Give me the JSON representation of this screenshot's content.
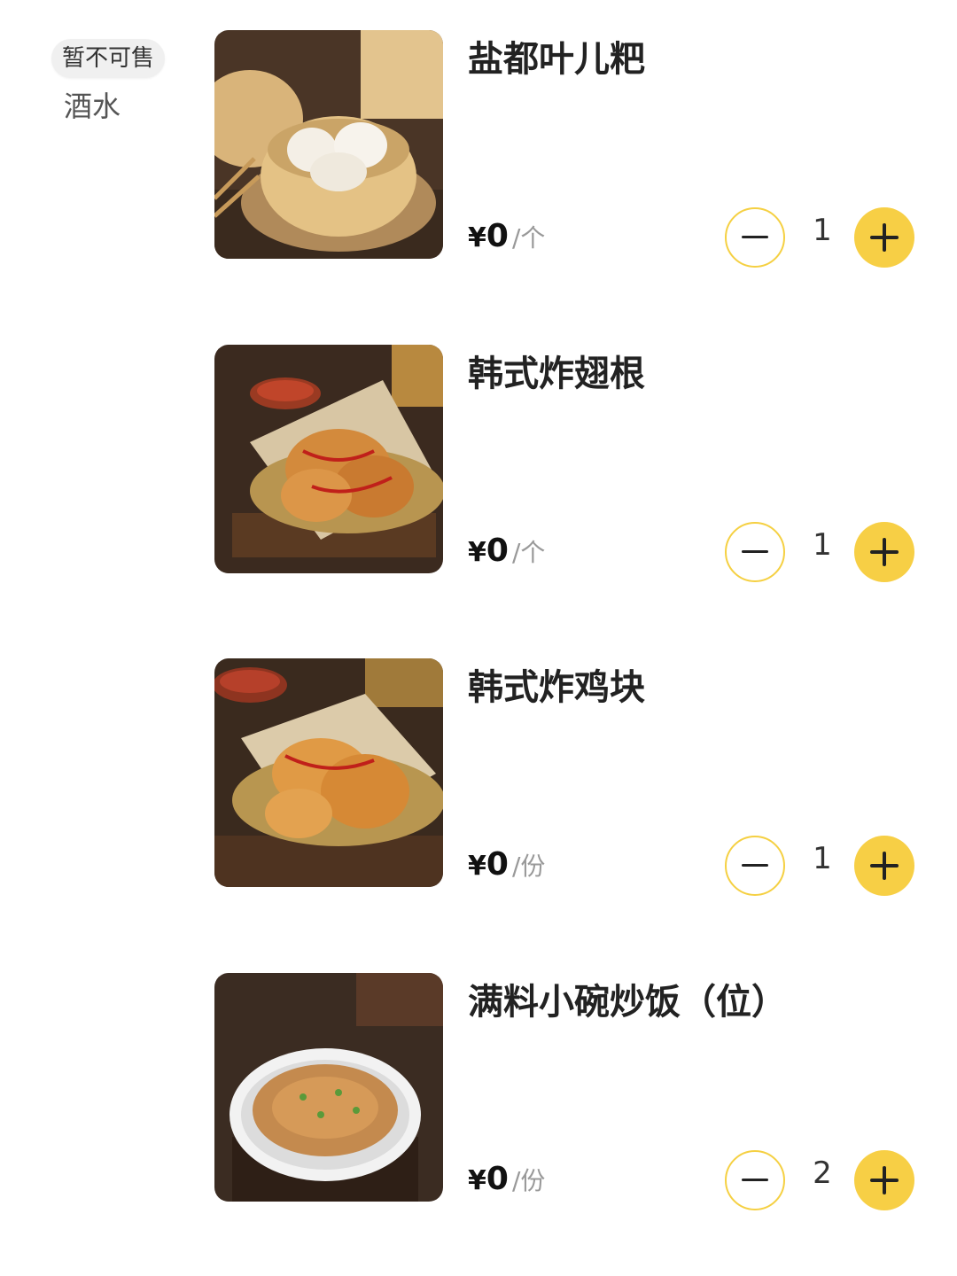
{
  "sidebar": {
    "status_badge": "暂不可售",
    "category": "酒水"
  },
  "items": [
    {
      "name": "盐都叶儿粑",
      "currency": "¥",
      "price": "0",
      "unit": "/个",
      "qty": "1",
      "image": "steamed-buns-photo"
    },
    {
      "name": "韩式炸翅根",
      "currency": "¥",
      "price": "0",
      "unit": "/个",
      "qty": "1",
      "image": "fried-wings-photo"
    },
    {
      "name": "韩式炸鸡块",
      "currency": "¥",
      "price": "0",
      "unit": "/份",
      "qty": "1",
      "image": "fried-chicken-photo"
    },
    {
      "name": "满料小碗炒饭（位）",
      "currency": "¥",
      "price": "0",
      "unit": "/份",
      "qty": "2",
      "image": "fried-rice-photo"
    }
  ],
  "colors": {
    "accent": "#f7cf45",
    "minus_border": "#f5d042",
    "unit_gray": "#999999"
  }
}
